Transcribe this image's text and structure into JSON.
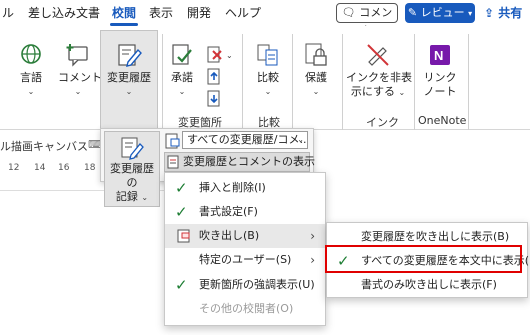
{
  "tabs": [
    "ル",
    "差し込み文書",
    "校閲",
    "表示",
    "開発",
    "ヘルプ"
  ],
  "active_tab": "校閲",
  "header_buttons": {
    "comment": "コメント",
    "review": "レビュー",
    "share": "共有"
  },
  "ribbon": {
    "language": "言語",
    "comment": "コメント",
    "track_changes": "変更履歴",
    "accept": "承諾",
    "compare": "比較",
    "protect": "保護",
    "ink_hide_line1": "インクを非表",
    "ink_hide_line2": "示にする",
    "link_line1": "リンク",
    "link_line2": "ノート",
    "group_changes": "変更箇所",
    "group_compare": "比較",
    "group_ink": "インク",
    "group_onenote": "OneNote",
    "bg_text": "ル描画キャンバス"
  },
  "ruler": [
    "12",
    "14",
    "16",
    "18"
  ],
  "track_panel": {
    "record_line1": "変更履歴の",
    "record_line2": "記録",
    "markup_dropdown": "すべての変更履歴/コメ...",
    "show_markup": "変更履歴とコメントの表示"
  },
  "menu": {
    "insert_delete": "挿入と削除(I)",
    "formatting": "書式設定(F)",
    "balloons": "吹き出し(B)",
    "specific_people": "特定のユーザー(S)",
    "highlight_updates": "更新箇所の強調表示(U)",
    "other_authors": "その他の校閲者(O)"
  },
  "submenu": {
    "show_revisions_in_balloons": "変更履歴を吹き出しに表示(B)",
    "show_all_inline": "すべての変更履歴を本文中に表示(I)",
    "show_formatting_only": "書式のみ吹き出しに表示(F)"
  },
  "colors": {
    "accent": "#185abd",
    "highlight": "#e00000",
    "check": "#1e7e34",
    "onenote": "#7719aa"
  }
}
